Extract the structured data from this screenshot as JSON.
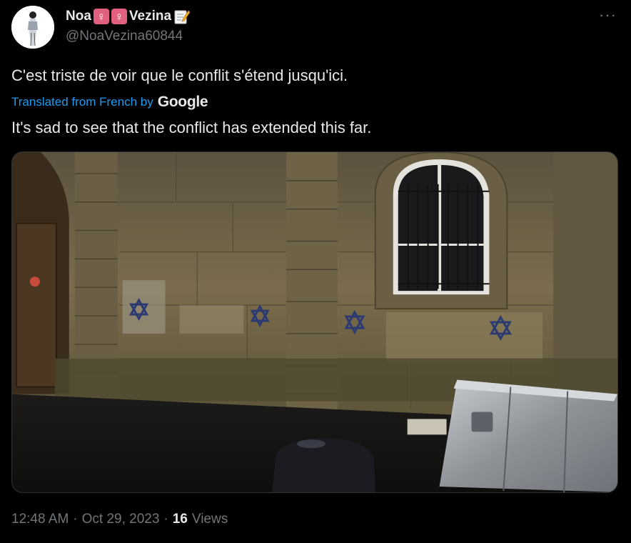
{
  "author": {
    "display_name_first": "Noa",
    "display_name_last": "Vezina",
    "emoji_1": "♀",
    "emoji_2": "♀",
    "emoji_3": "memo-icon",
    "handle": "@NoaVezina60844"
  },
  "more_icon": "more-horizontal-icon",
  "more_glyph": "···",
  "tweet": {
    "text": "C'est triste de voir que le conflit s'étend jusqu'ici.",
    "translated_label": "Translated from French by",
    "translation_provider": "Google",
    "translation": "It's sad to see that the conflict has extended this far."
  },
  "media": {
    "icon": "photo"
  },
  "meta": {
    "time": "12:48 AM",
    "sep1": "·",
    "date": "Oct 29, 2023",
    "sep2": "·",
    "views_count": "16",
    "views_label": "Views"
  },
  "colors": {
    "background": "#000000",
    "text": "#e7e9ea",
    "secondary": "#71767b",
    "link": "#1d9bf0"
  }
}
